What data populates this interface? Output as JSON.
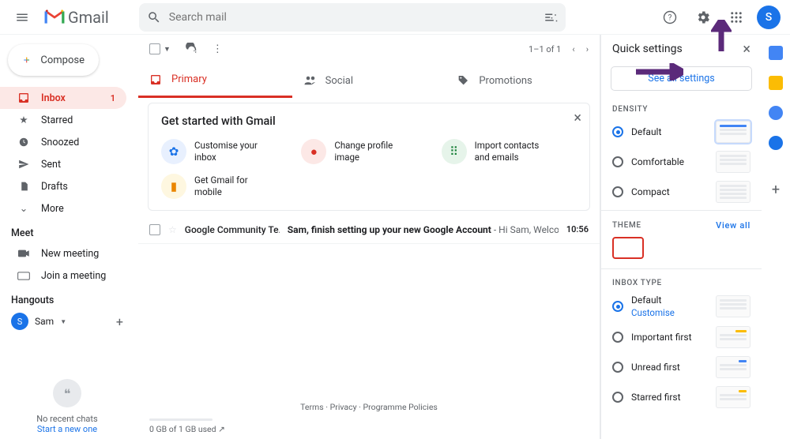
{
  "header": {
    "app": "Gmail",
    "search_placeholder": "Search mail",
    "avatar_initial": "S"
  },
  "sidebar": {
    "compose": "Compose",
    "items": [
      {
        "label": "Inbox",
        "count": "1",
        "icon": "inbox"
      },
      {
        "label": "Starred",
        "icon": "star"
      },
      {
        "label": "Snoozed",
        "icon": "clock"
      },
      {
        "label": "Sent",
        "icon": "send"
      },
      {
        "label": "Drafts",
        "icon": "file"
      },
      {
        "label": "More",
        "icon": "chev"
      }
    ],
    "meet_head": "Meet",
    "meet": [
      {
        "label": "New meeting",
        "icon": "video"
      },
      {
        "label": "Join a meeting",
        "icon": "keyboard"
      }
    ],
    "hangouts_head": "Hangouts",
    "user_name": "Sam",
    "user_initial": "S",
    "empty1": "No recent chats",
    "empty2": "Start a new one"
  },
  "toolbar": {
    "count": "1–1 of 1"
  },
  "tabs": [
    {
      "label": "Primary"
    },
    {
      "label": "Social"
    },
    {
      "label": "Promotions"
    }
  ],
  "card": {
    "title": "Get started with Gmail",
    "items": [
      {
        "line1": "Customise your",
        "line2": "inbox"
      },
      {
        "line1": "Change profile",
        "line2": "image"
      },
      {
        "line1": "Import contacts",
        "line2": "and emails"
      },
      {
        "line1": "Get Gmail for",
        "line2": "mobile"
      }
    ]
  },
  "emails": [
    {
      "sender": "Google Community Te.",
      "subject": "Sam, finish setting up your new Google Account",
      "snippet": " - Hi Sam, Welco..",
      "time": "10:56"
    }
  ],
  "footer": {
    "links": "Terms · Privacy · Programme Policies",
    "storage": "0 GB of 1 GB used"
  },
  "qsettings": {
    "title": "Quick settings",
    "all": "See all settings",
    "density_head": "DENSITY",
    "density": [
      "Default",
      "Comfortable",
      "Compact"
    ],
    "theme_head": "THEME",
    "viewall": "View all",
    "inboxtype_head": "INBOX TYPE",
    "inbox_types": [
      {
        "label": "Default",
        "sub": "Customise"
      },
      {
        "label": "Important first"
      },
      {
        "label": "Unread first"
      },
      {
        "label": "Starred first"
      }
    ]
  }
}
